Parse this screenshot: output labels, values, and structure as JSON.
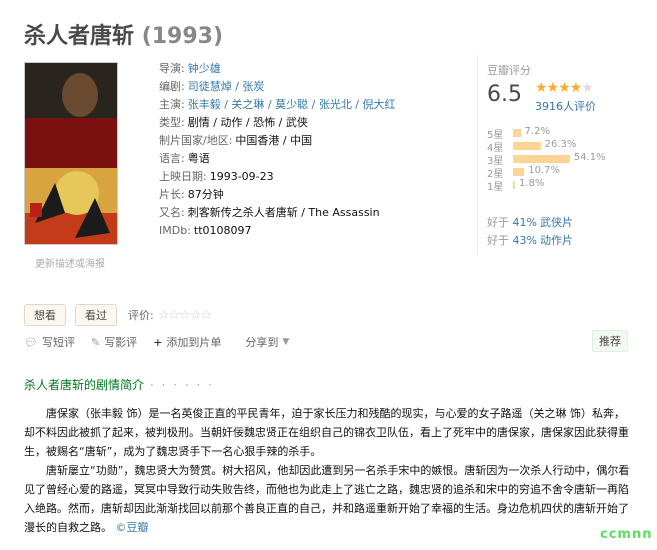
{
  "movie": {
    "title": "杀人者唐斩",
    "year": "(1993)",
    "poster_caption": "更新描述或海报",
    "info": [
      {
        "label": "导演:",
        "value": "钟少雄",
        "links": true
      },
      {
        "label": "编剧:",
        "value": "司徒慧焯 / 张炭",
        "links": true
      },
      {
        "label": "主演:",
        "value": "张丰毅 / 关之琳 / 莫少聪 / 张光北 / 倪大红",
        "links": true
      },
      {
        "label": "类型:",
        "value": "剧情 / 动作 / 恐怖 / 武侠",
        "links": false
      },
      {
        "label": "制片国家/地区:",
        "value": "中国香港 / 中国",
        "links": false
      },
      {
        "label": "语言:",
        "value": "粤语",
        "links": false
      },
      {
        "label": "上映日期:",
        "value": "1993-09-23",
        "links": false
      },
      {
        "label": "片长:",
        "value": "87分钟",
        "links": false
      },
      {
        "label": "又名:",
        "value": "刺客新传之杀人者唐斩 / The Assassin",
        "links": false
      },
      {
        "label": "IMDb:",
        "value": "tt0108097",
        "links": false
      }
    ]
  },
  "rating": {
    "label": "豆瓣评分",
    "score": "6.5",
    "stars_filled": 3.5,
    "votes": "3916人评价",
    "distribution": [
      {
        "level": "5星",
        "pct": "7.2%",
        "value": 7.2
      },
      {
        "level": "4星",
        "pct": "26.3%",
        "value": 26.3
      },
      {
        "level": "3星",
        "pct": "54.1%",
        "value": 54.1
      },
      {
        "level": "2星",
        "pct": "10.7%",
        "value": 10.7
      },
      {
        "level": "1星",
        "pct": "1.8%",
        "value": 1.8
      }
    ],
    "better_than": [
      {
        "prefix": "好于 ",
        "pct": "41%",
        "genre": "武侠片"
      },
      {
        "prefix": "好于 ",
        "pct": "43%",
        "genre": "动作片"
      }
    ]
  },
  "buttons": {
    "want": "想看",
    "seen": "看过",
    "rate_label": "评价:",
    "rate_stars": "☆☆☆☆☆"
  },
  "actions": {
    "short_review": "写短评",
    "review": "写影评",
    "add_list": "添加到片单",
    "share": "分享到",
    "recommend": "推荐"
  },
  "intro": {
    "title": "杀人者唐斩的剧情简介",
    "dots": "· · · · · ·",
    "paragraphs": [
      "唐保家（张丰毅 饰）是一名英俊正直的平民青年，迫于家长压力和残酷的现实，与心爱的女子路遥（关之琳 饰）私奔，却不料因此被抓了起来，被判极刑。当朝奸佞魏忠贤正在组织自己的锦衣卫队伍，看上了死牢中的唐保家，唐保家因此获得重生，被赐名“唐斩”，成为了魏忠贤手下一名心狠手辣的杀手。",
      "唐斩屡立“功勋”，魏忠贤大为赞赏。树大招风，他却因此遭到另一名杀手宋中的嫉恨。唐斩因为一次杀人行动中，偶尔看见了曾经心爱的路遥，冥冥中导致行动失败告终，而他也为此走上了逃亡之路，魏忠贤的追杀和宋中的穷追不舍令唐斩一再陷入绝路。然而，唐斩却因此渐渐找回以前那个善良正直的自己，并和路遥重新开始了幸福的生活。身边危机四伏的唐斩开始了漫长的自救之路。"
    ],
    "source": "©豆瓣"
  },
  "watermark": "ccmnn"
}
